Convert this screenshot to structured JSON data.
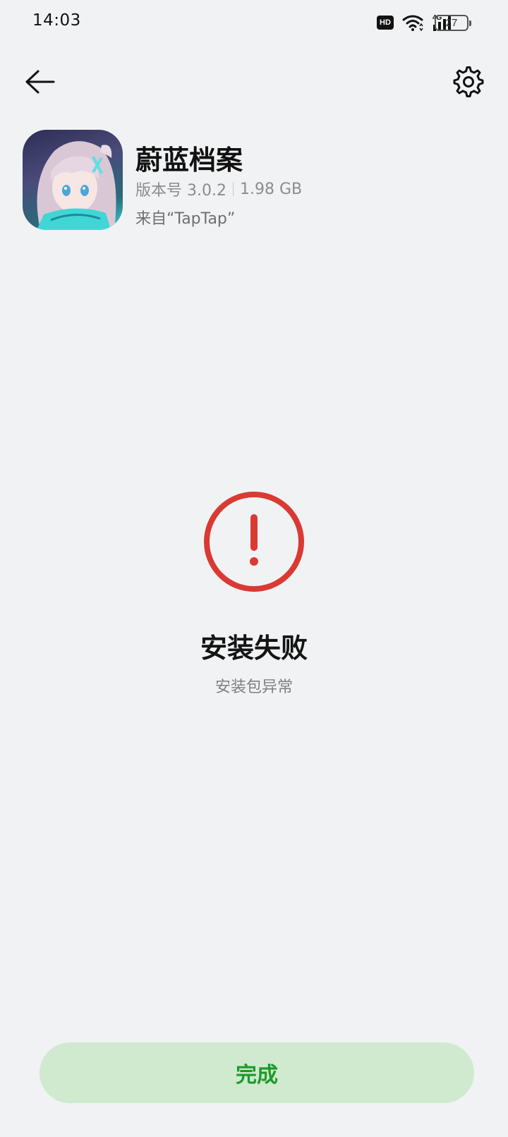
{
  "status_bar": {
    "time": "14:03",
    "hd_label": "HD",
    "network_label": "4G",
    "battery_level": "27"
  },
  "header": {
    "back_icon": "arrow-left-icon",
    "settings_icon": "gear-icon"
  },
  "app": {
    "name": "蔚蓝档案",
    "version": "版本号 3.0.2",
    "size": "1.98 GB",
    "source": "来自“TapTap”"
  },
  "result": {
    "icon": "error-exclamation-icon",
    "title": "安装失败",
    "subtitle": "安装包异常",
    "accent_color": "#d93a33"
  },
  "footer": {
    "done_label": "完成",
    "button_color": "#cfeacf",
    "text_color": "#1e9a2a"
  }
}
